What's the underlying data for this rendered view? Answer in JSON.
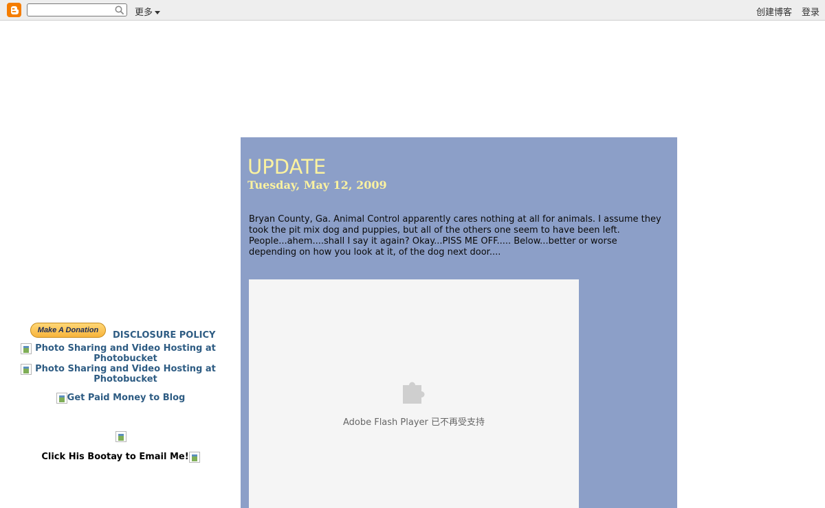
{
  "navbar": {
    "search": {
      "value": "",
      "placeholder": ""
    },
    "more_label": "更多",
    "create_blog_label": "创建博客",
    "login_label": "登录",
    "logo_color": "#f57d00"
  },
  "sidebar": {
    "donate_label": "Make A Donation",
    "disclosure_label": "DISCLOSURE POLICY",
    "photo_links": [
      "Photo Sharing and Video Hosting at Photobucket",
      "Photo Sharing and Video Hosting at Photobucket"
    ],
    "paid_label": "Get Paid Money to Blog",
    "bootay_label": "Click His Bootay to Email Me!"
  },
  "post": {
    "title": "UPDATE",
    "date": "Tuesday, May 12, 2009",
    "body": "Bryan County, Ga. Animal Control apparently cares nothing at all for animals. I assume they took the pit mix dog and puppies, but all of the others one seem to have been left. People...ahem....shall I say it again? Okay...PISS ME OFF..... Below...better or worse depending on how you look at it, of the dog next door....",
    "flash_message": "Adobe Flash Player 已不再受支持",
    "background_color": "#8c9fc8",
    "title_color": "#fbf2a0"
  }
}
